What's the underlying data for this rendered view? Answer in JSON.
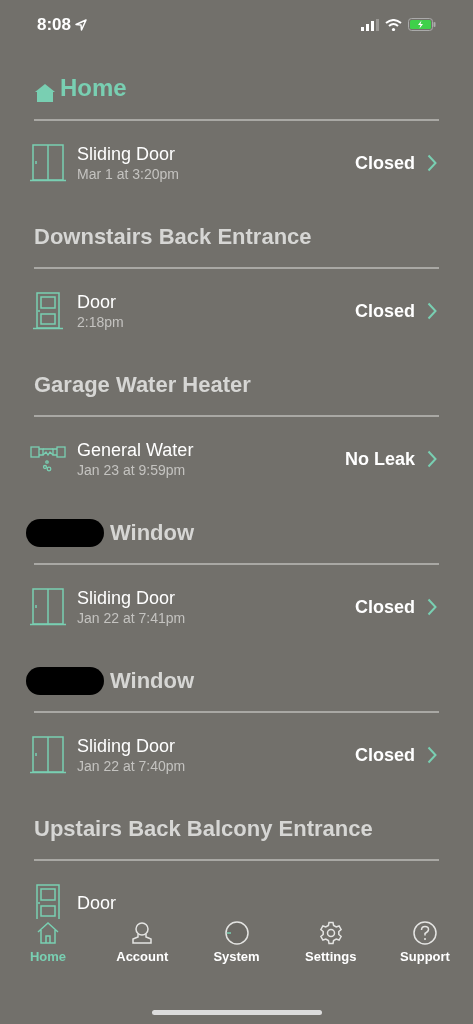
{
  "status_bar": {
    "time": "8:08"
  },
  "sections": [
    {
      "kind": "home",
      "title": "Home",
      "redacted": false,
      "devices": [
        {
          "kind": "sliding_door",
          "name": "Sliding Door",
          "time": "Mar 1 at 3:20pm",
          "status": "Closed"
        }
      ]
    },
    {
      "kind": "location",
      "title": "Downstairs Back Entrance",
      "redacted": false,
      "devices": [
        {
          "kind": "door",
          "name": "Door",
          "time": "2:18pm",
          "status": "Closed"
        }
      ]
    },
    {
      "kind": "location",
      "title": "Garage Water Heater",
      "redacted": false,
      "devices": [
        {
          "kind": "water",
          "name": "General Water",
          "time": "Jan 23 at 9:59pm",
          "status": "No Leak"
        }
      ]
    },
    {
      "kind": "location",
      "title": "Window",
      "redacted": true,
      "devices": [
        {
          "kind": "sliding_door",
          "name": "Sliding Door",
          "time": "Jan 22 at 7:41pm",
          "status": "Closed"
        }
      ]
    },
    {
      "kind": "location",
      "title": "Window",
      "redacted": true,
      "devices": [
        {
          "kind": "sliding_door",
          "name": "Sliding Door",
          "time": "Jan 22 at 7:40pm",
          "status": "Closed"
        }
      ]
    },
    {
      "kind": "location",
      "title": "Upstairs Back Balcony Entrance",
      "redacted": false,
      "devices": [
        {
          "kind": "door",
          "name": "Door"
        }
      ]
    }
  ],
  "tabs": [
    {
      "kind": "home",
      "label": "Home",
      "selected": true
    },
    {
      "kind": "account",
      "label": "Account",
      "selected": false
    },
    {
      "kind": "system",
      "label": "System",
      "selected": false
    },
    {
      "kind": "settings",
      "label": "Settings",
      "selected": false
    },
    {
      "kind": "support",
      "label": "Support",
      "selected": false
    }
  ]
}
